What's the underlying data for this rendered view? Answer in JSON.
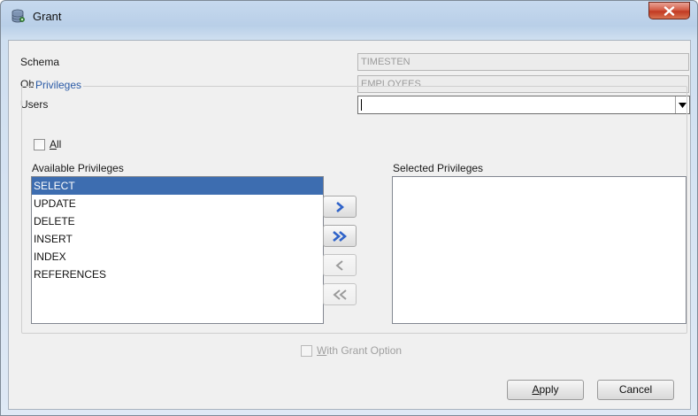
{
  "window": {
    "title": "Grant",
    "icons": {
      "app": "database-key-icon",
      "close": "close-icon"
    },
    "colors": {
      "close_button": "#c7412a",
      "selection": "#3d6db0",
      "group_title": "#2a5aa6"
    }
  },
  "form": {
    "schema_label": "Schema",
    "schema_value": "TIMESTEN",
    "object_name_label": "Object Name",
    "object_name_value": "EMPLOYEES",
    "users_label": "Users",
    "users_value": ""
  },
  "privileges": {
    "group_title": "Privileges",
    "all_label_mnemonic": "A",
    "all_label_rest": "ll",
    "all_checked": false,
    "available_label": "Available Privileges",
    "selected_label": "Selected Privileges",
    "available": [
      "SELECT",
      "UPDATE",
      "DELETE",
      "INSERT",
      "INDEX",
      "REFERENCES"
    ],
    "selected_index": 0,
    "selected": [],
    "buttons": {
      "add_one": "chevron-right-icon",
      "add_all": "double-chevron-right-icon",
      "remove_one": "chevron-left-icon",
      "remove_all": "double-chevron-left-icon"
    }
  },
  "grant_option": {
    "label_mnemonic": "W",
    "label_rest": "ith Grant Option",
    "checked": false,
    "enabled": false
  },
  "footer": {
    "apply_mnemonic": "A",
    "apply_rest": "pply",
    "cancel_label": "Cancel"
  }
}
